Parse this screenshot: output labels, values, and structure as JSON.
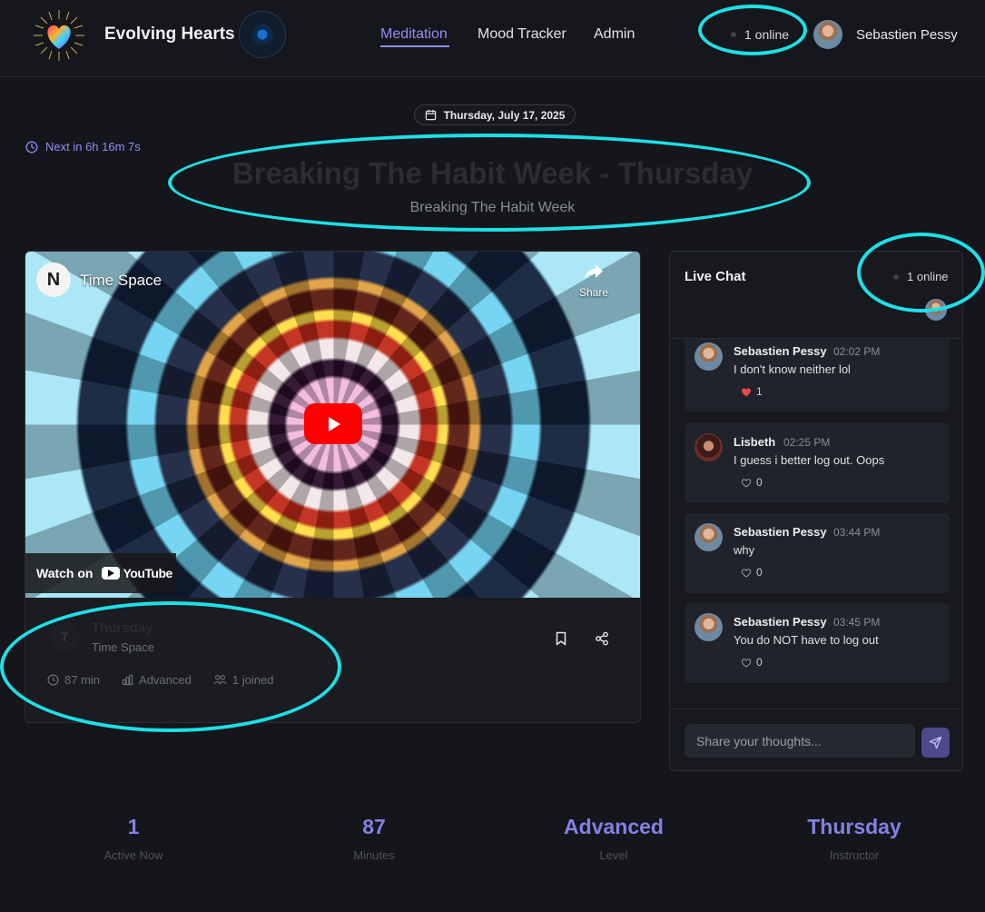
{
  "header": {
    "brand": "Evolving Hearts",
    "nav": [
      {
        "label": "Meditation",
        "active": true
      },
      {
        "label": "Mood Tracker",
        "active": false
      },
      {
        "label": "Admin",
        "active": false
      }
    ],
    "online": "1 online",
    "user_name": "Sebastien Pessy"
  },
  "date": "Thursday, July 17, 2025",
  "next_in": "Next in 6h 16m 7s",
  "session": {
    "title": "Breaking The Habit Week - Thursday",
    "subtitle": "Breaking The Habit Week"
  },
  "video": {
    "channel": "Time Space",
    "channel_initial": "N",
    "share_label": "Share",
    "watch_on": "Watch on",
    "youtube": "YouTube"
  },
  "video_meta": {
    "avatar_initial": "T",
    "title": "Thursday",
    "channel": "Time Space",
    "duration": "87 min",
    "level": "Advanced",
    "joined": "1 joined"
  },
  "chat": {
    "title": "Live Chat",
    "online": "1 online",
    "input_placeholder": "Share your thoughts...",
    "messages": [
      {
        "name": "Sebastien Pessy",
        "time": "02:02 PM",
        "text": "I don't know neither lol",
        "likes": "1",
        "liked": true
      },
      {
        "name": "Lisbeth",
        "time": "02:25 PM",
        "text": "I guess i better log out. Oops",
        "likes": "0",
        "liked": false
      },
      {
        "name": "Sebastien Pessy",
        "time": "03:44 PM",
        "text": "why",
        "likes": "0",
        "liked": false
      },
      {
        "name": "Sebastien Pessy",
        "time": "03:45 PM",
        "text": "You do NOT have to log out",
        "likes": "0",
        "liked": false
      }
    ]
  },
  "stats": [
    {
      "value": "1",
      "label": "Active Now"
    },
    {
      "value": "87",
      "label": "Minutes"
    },
    {
      "value": "Advanced",
      "label": "Level"
    },
    {
      "value": "Thursday",
      "label": "Instructor"
    }
  ],
  "colors": {
    "accent": "#8f8ff3",
    "background": "#14161b",
    "annotation": "#1fdfe6",
    "like_red": "#e5484d"
  }
}
